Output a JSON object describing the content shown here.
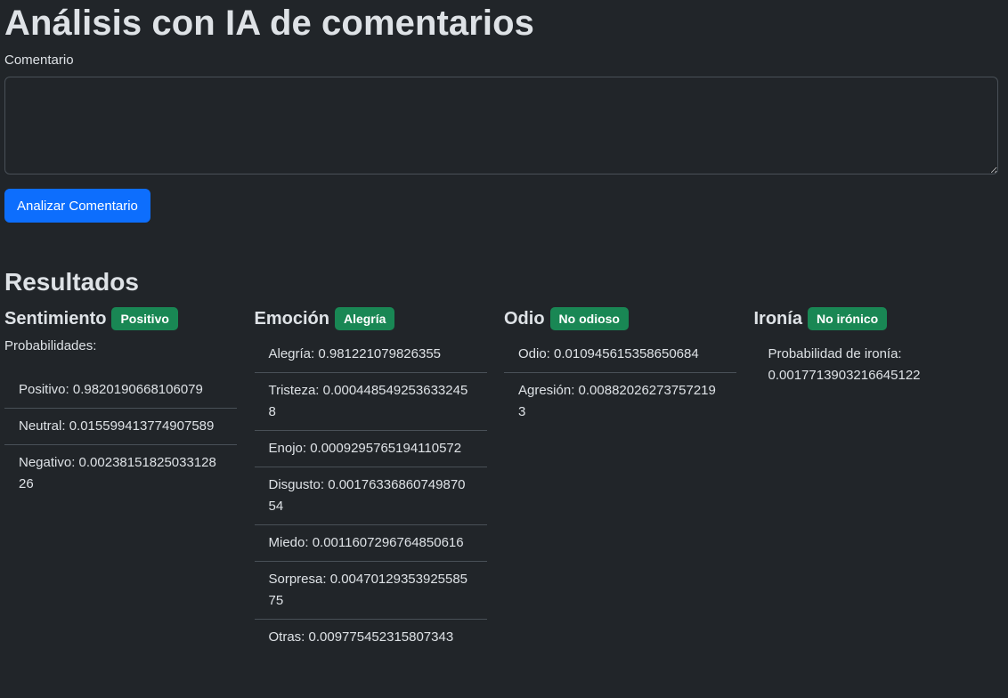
{
  "page": {
    "title": "Análisis con IA de comentarios",
    "comment_label": "Comentario",
    "comment_value": "",
    "analyze_button": "Analizar Comentario",
    "results_title": "Resultados"
  },
  "sentiment": {
    "title": "Sentimiento",
    "badge": "Positivo",
    "prob_label": "Probabilidades:",
    "items": [
      {
        "text": "Positivo: 0.9820190668106079"
      },
      {
        "text": "Neutral: 0.015599413774907589"
      },
      {
        "text": "Negativo: 0.0023815182503312826"
      }
    ]
  },
  "emotion": {
    "title": "Emoción",
    "badge": "Alegría",
    "items": [
      {
        "text": "Alegría: 0.981221079826355"
      },
      {
        "text": "Tristeza: 0.0004485492536332458"
      },
      {
        "text": "Enojo: 0.0009295765194110572"
      },
      {
        "text": "Disgusto: 0.0017633686074987054"
      },
      {
        "text": "Miedo: 0.0011607296764850616"
      },
      {
        "text": "Sorpresa: 0.0047012935392558575"
      },
      {
        "text": "Otras: 0.009775452315807343"
      }
    ]
  },
  "hate": {
    "title": "Odio",
    "badge": "No odioso",
    "items": [
      {
        "text": "Odio: 0.010945615358650684"
      },
      {
        "text": "Agresión: 0.008820262737572193"
      }
    ]
  },
  "irony": {
    "title": "Ironía",
    "badge": "No irónico",
    "text": "Probabilidad de ironía: 0.0017713903216645122"
  },
  "colors": {
    "background": "#212529",
    "text": "#dee2e6",
    "primary_button": "#0d6efd",
    "success_badge": "#198754",
    "divider": "#495057"
  }
}
